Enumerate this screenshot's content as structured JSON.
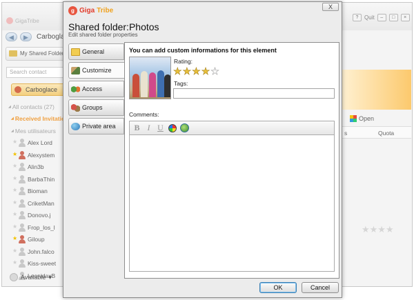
{
  "main": {
    "app_name": "GigaTribe",
    "quit_label": "Quit",
    "breadcrumb": "Carboglace",
    "my_shared_label": "My Shared Folders",
    "search_placeholder": "Search contact",
    "current_user": "Carboglace",
    "contacts": [
      {
        "label": "All contacts (27)",
        "kind": "group"
      },
      {
        "label": "Received Invitations",
        "kind": "received"
      },
      {
        "label": "Mes utilisateurs",
        "kind": "group"
      },
      {
        "label": "Alex Lord",
        "kind": "contact",
        "fav": false,
        "online": false
      },
      {
        "label": "Alexystem",
        "kind": "contact",
        "fav": true,
        "online": true
      },
      {
        "label": "Alin3b",
        "kind": "contact",
        "fav": false,
        "online": false
      },
      {
        "label": "BarbaThin",
        "kind": "contact",
        "fav": false,
        "online": false
      },
      {
        "label": "Bioman",
        "kind": "contact",
        "fav": false,
        "online": false
      },
      {
        "label": "CriketMan",
        "kind": "contact",
        "fav": false,
        "online": false
      },
      {
        "label": "Donovo.j",
        "kind": "contact",
        "fav": false,
        "online": false
      },
      {
        "label": "Frop_los_l",
        "kind": "contact",
        "fav": false,
        "online": false
      },
      {
        "label": "Giloup",
        "kind": "contact",
        "fav": true,
        "online": true
      },
      {
        "label": "John.falco",
        "kind": "contact",
        "fav": false,
        "online": false
      },
      {
        "label": "Kiss-sweet",
        "kind": "contact",
        "fav": false,
        "online": false
      },
      {
        "label": "LeonidaxB",
        "kind": "contact",
        "fav": false,
        "online": false
      }
    ],
    "status_label": "Available",
    "open_label": "Open",
    "col_quota": "Quota",
    "right_stars": "★★★★"
  },
  "dialog": {
    "brand_giga": "Giga",
    "brand_tribe": "Tribe",
    "close_label": "X",
    "title": "Shared folder:Photos",
    "subtitle": "Edit shared folder properties",
    "tabs": [
      {
        "label": "General",
        "icon": "folder-icon"
      },
      {
        "label": "Customize",
        "icon": "brush-icon",
        "active": true
      },
      {
        "label": "Access",
        "icon": "access-icon"
      },
      {
        "label": "Groups",
        "icon": "groups-icon"
      },
      {
        "label": "Private area",
        "icon": "globe-icon"
      }
    ],
    "panel_heading": "You can add custom informations for this element",
    "rating_label": "Rating:",
    "rating": 4,
    "rating_max": 5,
    "tags_label": "Tags:",
    "tags_value": "",
    "comments_label": "Comments:",
    "comments_value": "",
    "toolbar": {
      "bold": "B",
      "italic": "I",
      "underline": "U"
    },
    "ok_label": "OK",
    "cancel_label": "Cancel"
  }
}
